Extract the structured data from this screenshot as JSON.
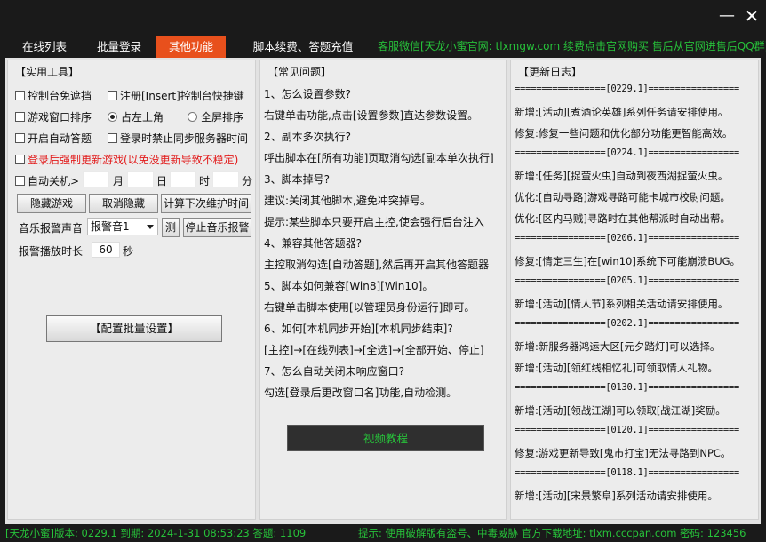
{
  "window": {
    "minimize_label": "—",
    "close_label": "✕"
  },
  "tabs": [
    {
      "label": "在线列表"
    },
    {
      "label": "批量登录"
    },
    {
      "label": "其他功能"
    },
    {
      "label": "脚本续费、答题充值"
    }
  ],
  "top_notice": "客服微信[天龙小蜜官网: tlxmgw.com 续费点击官网购买 售后从官网进售后QQ群]",
  "tools": {
    "title": "【实用工具】",
    "options": {
      "console_no_cover": "控制台免遮挡",
      "register_insert": "注册[Insert]控制台快捷键",
      "window_sort": "游戏窗口排序",
      "top_left": "占左上角",
      "fullscreen_sort": "全屏排序",
      "auto_answer": "开启自动答题",
      "disable_sync_time": "登录时禁止同步服务器时间",
      "force_update": "登录后强制更新游戏(以免没更新导致不稳定)",
      "auto_shutdown": "自动关机>"
    },
    "time_units": {
      "month": "月",
      "day": "日",
      "hour": "时",
      "minute": "分"
    },
    "buttons": {
      "hide_game": "隐藏游戏",
      "cancel_hide": "取消隐藏",
      "calc_maintenance": "计算下次维护时间",
      "test": "测",
      "stop_music": "停止音乐报警",
      "batch_config": "【配置批量设置】"
    },
    "alarm_sound_label": "音乐报警声音",
    "alarm_sound_value": "报警音1",
    "alarm_duration_label": "报警播放时长",
    "alarm_duration_value": "60",
    "alarm_duration_unit": "秒"
  },
  "faq": {
    "title": "【常见问题】",
    "lines": [
      "1、怎么设置参数?",
      "右键单击功能,点击[设置参数]直达参数设置。",
      "2、副本多次执行?",
      "呼出脚本在[所有功能]页取消勾选[副本单次执行]",
      "3、脚本掉号?",
      "建议:关闭其他脚本,避免冲突掉号。",
      "提示:某些脚本只要开启主控,使会强行后台注入",
      "4、兼容其他答题器?",
      "主控取消勾选[自动答题],然后再开启其他答题器",
      "5、脚本如何兼容[Win8][Win10]。",
      "右键单击脚本使用[以管理员身份运行]即可。",
      "6、如何[本机同步开始][本机同步结束]?",
      "[主控]→[在线列表]→[全选]→[全部开始、停止]",
      "7、怎么自动关闭未响应窗口?",
      "    勾选[登录后更改窗口名]功能,自动检测。"
    ],
    "video_button": "视频教程"
  },
  "changelog": {
    "title": "【更新日志】",
    "lines": [
      "=================[0229.1]=================",
      "新增:[活动][煮酒论英雄]系列任务请安排使用。",
      "修复:修复一些问题和优化部分功能更智能高效。",
      "=================[0224.1]=================",
      "新增:[任务][捉萤火虫]自动到夜西湖捉萤火虫。",
      "优化:[自动寻路]游戏寻路可能卡城市校尉问题。",
      "优化:[区内马贼]寻路时在其他帮派时自动出帮。",
      "=================[0206.1]=================",
      "修复:[情定三生]在[win10]系统下可能崩溃BUG。",
      "=================[0205.1]=================",
      "新增:[活动][情人节]系列相关活动请安排使用。",
      "=================[0202.1]=================",
      "新增:新服务器鸿运大区[元夕踏灯]可以选择。",
      "新增:[活动][领红线相忆礼]可领取情人礼物。",
      "=================[0130.1]=================",
      "新增:[活动][领战江湖]可以领取[战江湖]奖励。",
      "=================[0120.1]=================",
      "修复:游戏更新导致[鬼市打宝]无法寻路到NPC。",
      "=================[0118.1]=================",
      "新增:[活动][宋景繁阜]系列活动请安排使用。"
    ]
  },
  "status": {
    "left": "[天龙小蜜]版本: 0229.1  到期: 2024-1-31 08:53:23  答题: 1109",
    "right": "提示: 使用破解版有盗号、中毒威胁 官方下载地址: tlxm.cccpan.com 密码: 123456"
  },
  "colors": {
    "accent": "#e8501c",
    "green_text": "#27c23a",
    "warning_red": "#e21b1b",
    "chrome_dark": "#1a1a1a"
  }
}
